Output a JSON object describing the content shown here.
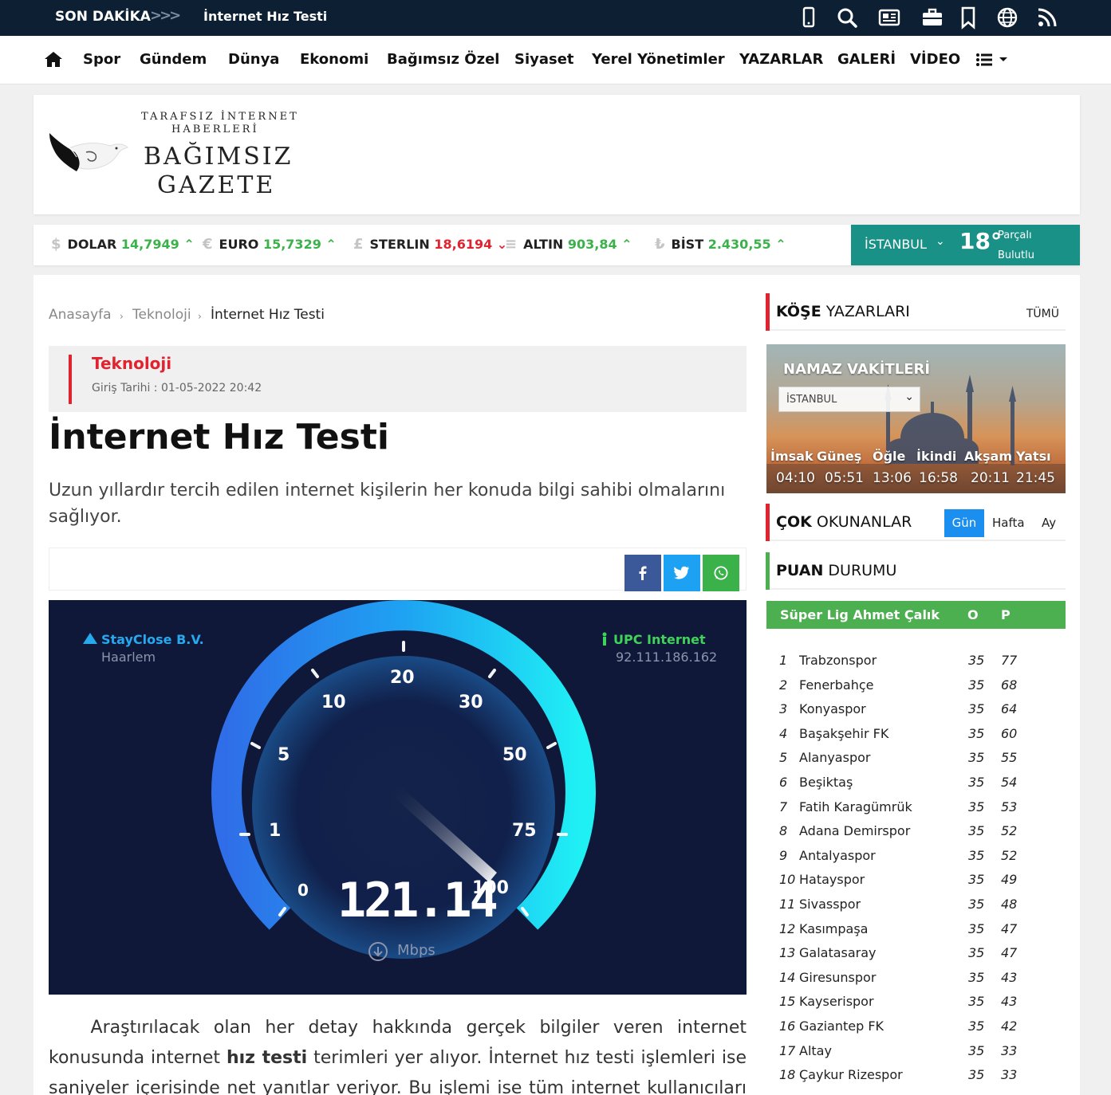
{
  "topbar": {
    "breaking_label": "SON DAKİKA",
    "breaking_arrows": ">>>",
    "breaking_headline": "İnternet Hız Testi"
  },
  "nav": {
    "items": [
      "Spor",
      "Gündem",
      "Dünya",
      "Ekonomi",
      "Bağımsız Özel",
      "Siyaset",
      "Yerel Yönetimler",
      "YAZARLAR",
      "GALERİ",
      "VİDEO"
    ]
  },
  "logo": {
    "line1": "TARAFSIZ İNTERNET",
    "line2": "HABERLERİ",
    "line3": "BAĞIMSIZ",
    "line4": "GAZETE"
  },
  "currency": {
    "items": [
      {
        "icon": "$",
        "name": "DOLAR",
        "value": "14,7949",
        "trend": "up"
      },
      {
        "icon": "€",
        "name": "EURO",
        "value": "15,7329",
        "trend": "up"
      },
      {
        "icon": "£",
        "name": "STERLIN",
        "value": "18,6194",
        "trend": "down"
      },
      {
        "icon": "≡",
        "name": "ALTIN",
        "value": "903,84",
        "trend": "up"
      },
      {
        "icon": "₺",
        "name": "BİST",
        "value": "2.430,55",
        "trend": "up"
      }
    ],
    "colors": {
      "up": "#3bb14a",
      "down": "#e0232f"
    }
  },
  "weather": {
    "city": "İSTANBUL",
    "temp": "18°",
    "cond_line1": "Parçalı",
    "cond_line2": "Bulutlu"
  },
  "breadcrumb": {
    "home": "Anasayfa",
    "category": "Teknoloji",
    "current": "İnternet Hız Testi"
  },
  "article": {
    "category": "Teknoloji",
    "date": "Giriş Tarihi : 01-05-2022 20:42",
    "title": "İnternet Hız Testi",
    "lead": "Uzun yıllardır tercih edilen internet kişilerin her konuda bilgi sahibi olmalarını sağlıyor.",
    "body_1": "Araştırılacak olan her detay hakkında gerçek bilgiler veren internet konusunda internet ",
    "body_bold": "hız testi",
    "body_2": " terimleri yer alıyor. İnternet hız testi işlemleri ise saniyeler içerisinde net yanıtlar veriyor. Bu işlemi ise tüm internet kullanıcıları kendi"
  },
  "speedtest": {
    "host_name": "StayClose B.V.",
    "host_city": "Haarlem",
    "isp_name": "UPC Internet",
    "isp_ip": "92.111.186.162",
    "scale": [
      "0",
      "1",
      "5",
      "10",
      "20",
      "30",
      "50",
      "75",
      "100"
    ],
    "reading": "121.14",
    "unit": "Mbps"
  },
  "sidebar": {
    "kose_title_bold": "KÖŞE",
    "kose_title_rest": " YAZARLARI",
    "kose_all": "TÜMÜ",
    "namaz_title": "NAMAZ VAKİTLERİ",
    "namaz_city": "İSTANBUL",
    "namaz_labels": [
      "İmsak",
      "Güneş",
      "Öğle",
      "İkindi",
      "Akşam",
      "Yatsı"
    ],
    "namaz_times": [
      "04:10",
      "05:51",
      "13:06",
      "16:58",
      "20:11",
      "21:45"
    ],
    "cok_title_bold": "ÇOK",
    "cok_title_rest": " OKUNANLAR",
    "cok_tabs": [
      "Gün",
      "Hafta",
      "Ay"
    ],
    "puan_title_bold": "PUAN",
    "puan_title_rest": " DURUMU",
    "league_name": "Süper Lig Ahmet Çalık",
    "col_o": "O",
    "col_p": "P",
    "standings": [
      {
        "rank": "1",
        "team": "Trabzonspor",
        "o": "35",
        "p": "77"
      },
      {
        "rank": "2",
        "team": "Fenerbahçe",
        "o": "35",
        "p": "68"
      },
      {
        "rank": "3",
        "team": "Konyaspor",
        "o": "35",
        "p": "64"
      },
      {
        "rank": "4",
        "team": "Başakşehir FK",
        "o": "35",
        "p": "60"
      },
      {
        "rank": "5",
        "team": "Alanyaspor",
        "o": "35",
        "p": "55"
      },
      {
        "rank": "6",
        "team": "Beşiktaş",
        "o": "35",
        "p": "54"
      },
      {
        "rank": "7",
        "team": "Fatih Karagümrük",
        "o": "35",
        "p": "53"
      },
      {
        "rank": "8",
        "team": "Adana Demirspor",
        "o": "35",
        "p": "52"
      },
      {
        "rank": "9",
        "team": "Antalyaspor",
        "o": "35",
        "p": "52"
      },
      {
        "rank": "10",
        "team": "Hatayspor",
        "o": "35",
        "p": "49"
      },
      {
        "rank": "11",
        "team": "Sivasspor",
        "o": "35",
        "p": "48"
      },
      {
        "rank": "12",
        "team": "Kasımpaşa",
        "o": "35",
        "p": "47"
      },
      {
        "rank": "13",
        "team": "Galatasaray",
        "o": "35",
        "p": "47"
      },
      {
        "rank": "14",
        "team": "Giresunspor",
        "o": "35",
        "p": "43"
      },
      {
        "rank": "15",
        "team": "Kayserispor",
        "o": "35",
        "p": "43"
      },
      {
        "rank": "16",
        "team": "Gaziantep FK",
        "o": "35",
        "p": "42"
      },
      {
        "rank": "17",
        "team": "Altay",
        "o": "35",
        "p": "33"
      },
      {
        "rank": "18",
        "team": "Çaykur Rizespor",
        "o": "35",
        "p": "33"
      }
    ]
  },
  "colors": {
    "accent_red": "#e0232f",
    "teal": "#199187",
    "green": "#4caf50",
    "facebook": "#3b5998",
    "twitter": "#1da1f2",
    "whatsapp": "#3bb14a",
    "tab_active": "#1a8ff0"
  }
}
